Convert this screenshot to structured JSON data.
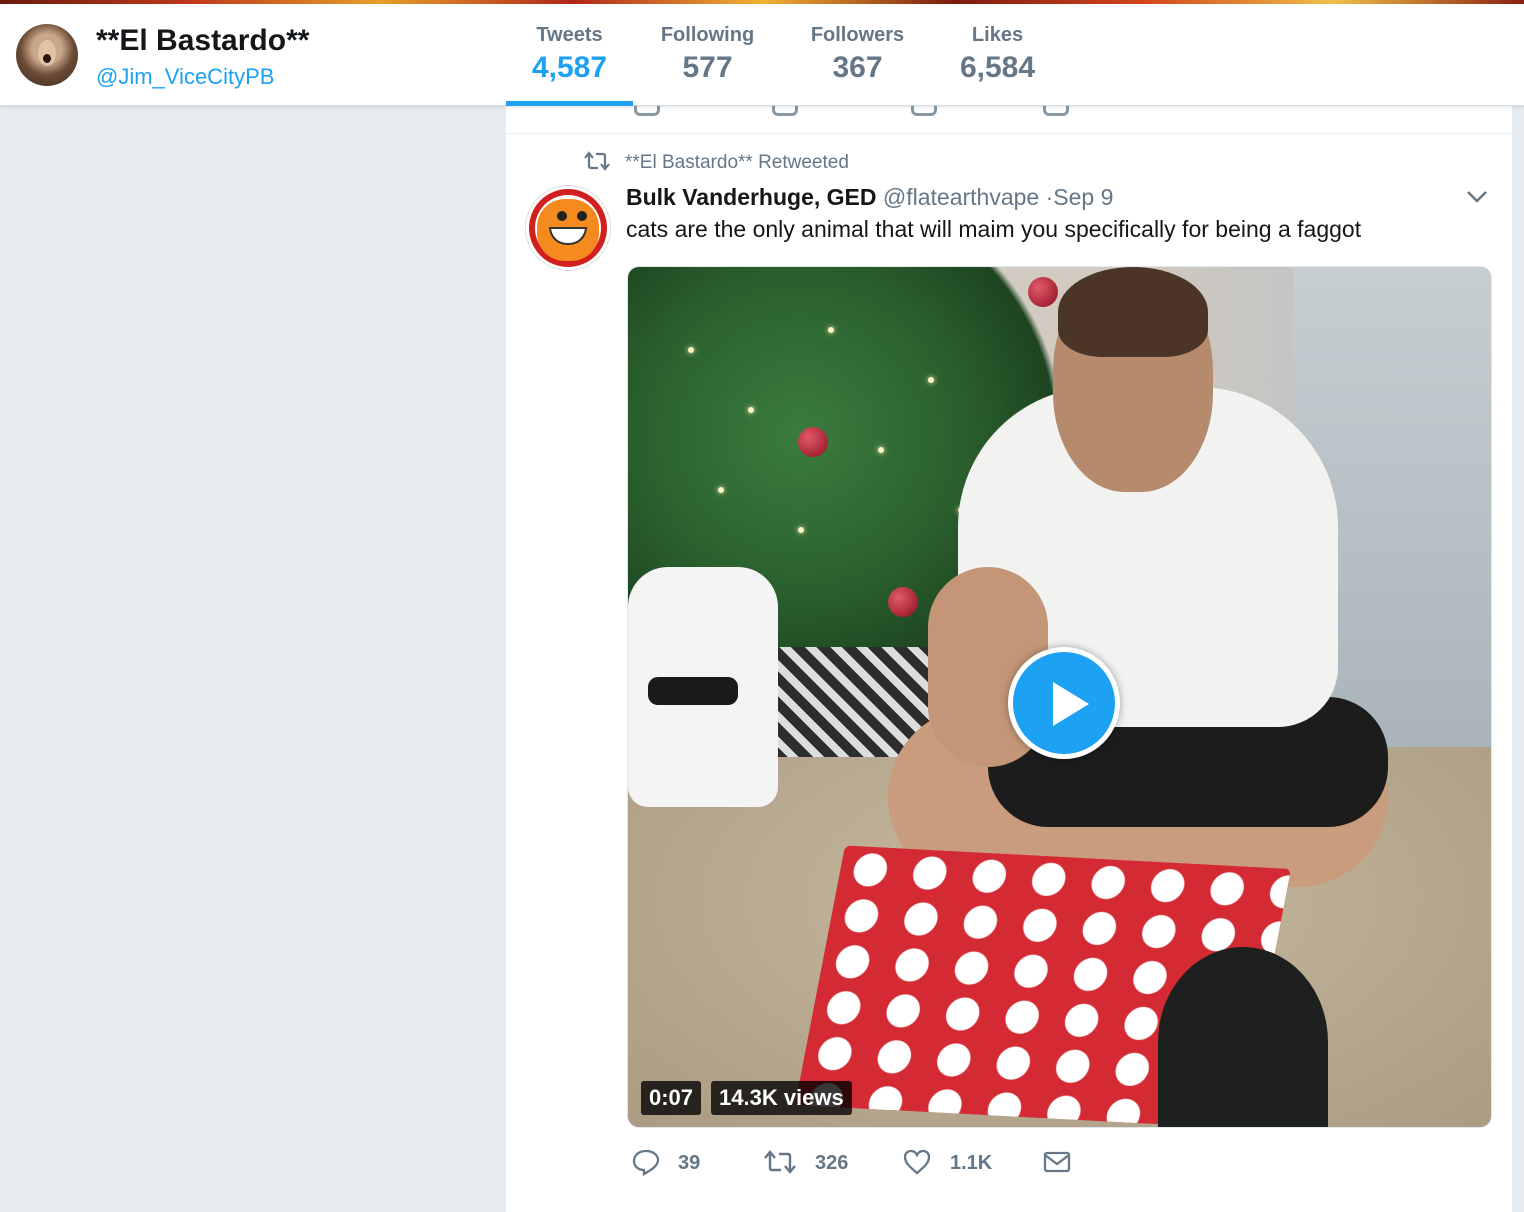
{
  "profile": {
    "name": "**El Bastardo**",
    "handle": "@Jim_ViceCityPB"
  },
  "stats": [
    {
      "label": "Tweets",
      "value": "4,587",
      "active": true
    },
    {
      "label": "Following",
      "value": "577",
      "active": false
    },
    {
      "label": "Followers",
      "value": "367",
      "active": false
    },
    {
      "label": "Likes",
      "value": "6,584",
      "active": false
    }
  ],
  "tweet": {
    "retweet_context": "**El Bastardo** Retweeted",
    "author_name": "Bulk Vanderhuge, GED",
    "author_handle": "@flatearthvape",
    "date": "·Sep 9",
    "text": "cats are the only animal that will maim you specifically for being a faggot",
    "video": {
      "duration": "0:07",
      "views": "14.3K views"
    },
    "actions": {
      "replies": "39",
      "retweets": "326",
      "likes": "1.1K"
    }
  },
  "colors": {
    "accent": "#1da1f2",
    "muted": "#657786",
    "text": "#14171a",
    "background": "#e6ecf0"
  },
  "icons": [
    "retweet-icon",
    "caret-down-icon",
    "play-icon",
    "reply-icon",
    "like-icon",
    "direct-message-icon"
  ]
}
